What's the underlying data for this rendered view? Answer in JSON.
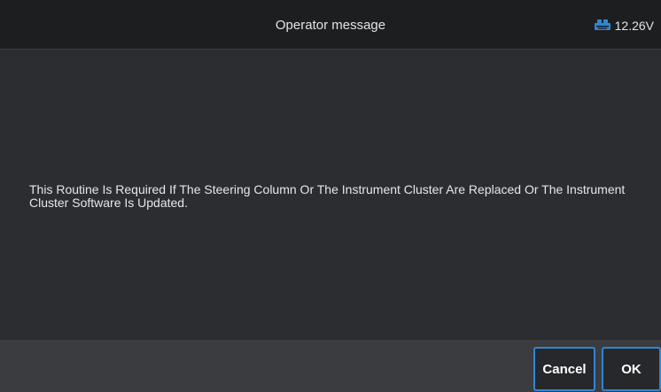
{
  "header": {
    "title": "Operator message",
    "voltage": "12.26V",
    "voltage_icon": "car-battery-icon",
    "accent_color": "#2f86d6"
  },
  "message": {
    "text": "This Routine Is Required If The Steering Column Or The Instrument Cluster Are Replaced Or The Instrument Cluster Software Is Updated."
  },
  "footer": {
    "cancel_label": "Cancel",
    "ok_label": "OK"
  }
}
